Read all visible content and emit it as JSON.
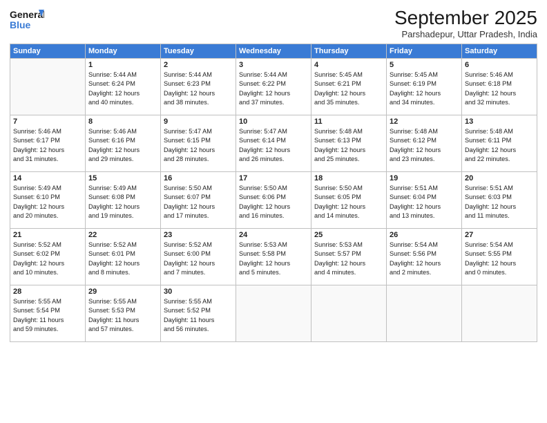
{
  "logo": {
    "line1": "General",
    "line2": "Blue"
  },
  "title": "September 2025",
  "location": "Parshadepur, Uttar Pradesh, India",
  "weekdays": [
    "Sunday",
    "Monday",
    "Tuesday",
    "Wednesday",
    "Thursday",
    "Friday",
    "Saturday"
  ],
  "weeks": [
    [
      {
        "day": "",
        "info": ""
      },
      {
        "day": "1",
        "info": "Sunrise: 5:44 AM\nSunset: 6:24 PM\nDaylight: 12 hours\nand 40 minutes."
      },
      {
        "day": "2",
        "info": "Sunrise: 5:44 AM\nSunset: 6:23 PM\nDaylight: 12 hours\nand 38 minutes."
      },
      {
        "day": "3",
        "info": "Sunrise: 5:44 AM\nSunset: 6:22 PM\nDaylight: 12 hours\nand 37 minutes."
      },
      {
        "day": "4",
        "info": "Sunrise: 5:45 AM\nSunset: 6:21 PM\nDaylight: 12 hours\nand 35 minutes."
      },
      {
        "day": "5",
        "info": "Sunrise: 5:45 AM\nSunset: 6:19 PM\nDaylight: 12 hours\nand 34 minutes."
      },
      {
        "day": "6",
        "info": "Sunrise: 5:46 AM\nSunset: 6:18 PM\nDaylight: 12 hours\nand 32 minutes."
      }
    ],
    [
      {
        "day": "7",
        "info": "Sunrise: 5:46 AM\nSunset: 6:17 PM\nDaylight: 12 hours\nand 31 minutes."
      },
      {
        "day": "8",
        "info": "Sunrise: 5:46 AM\nSunset: 6:16 PM\nDaylight: 12 hours\nand 29 minutes."
      },
      {
        "day": "9",
        "info": "Sunrise: 5:47 AM\nSunset: 6:15 PM\nDaylight: 12 hours\nand 28 minutes."
      },
      {
        "day": "10",
        "info": "Sunrise: 5:47 AM\nSunset: 6:14 PM\nDaylight: 12 hours\nand 26 minutes."
      },
      {
        "day": "11",
        "info": "Sunrise: 5:48 AM\nSunset: 6:13 PM\nDaylight: 12 hours\nand 25 minutes."
      },
      {
        "day": "12",
        "info": "Sunrise: 5:48 AM\nSunset: 6:12 PM\nDaylight: 12 hours\nand 23 minutes."
      },
      {
        "day": "13",
        "info": "Sunrise: 5:48 AM\nSunset: 6:11 PM\nDaylight: 12 hours\nand 22 minutes."
      }
    ],
    [
      {
        "day": "14",
        "info": "Sunrise: 5:49 AM\nSunset: 6:10 PM\nDaylight: 12 hours\nand 20 minutes."
      },
      {
        "day": "15",
        "info": "Sunrise: 5:49 AM\nSunset: 6:08 PM\nDaylight: 12 hours\nand 19 minutes."
      },
      {
        "day": "16",
        "info": "Sunrise: 5:50 AM\nSunset: 6:07 PM\nDaylight: 12 hours\nand 17 minutes."
      },
      {
        "day": "17",
        "info": "Sunrise: 5:50 AM\nSunset: 6:06 PM\nDaylight: 12 hours\nand 16 minutes."
      },
      {
        "day": "18",
        "info": "Sunrise: 5:50 AM\nSunset: 6:05 PM\nDaylight: 12 hours\nand 14 minutes."
      },
      {
        "day": "19",
        "info": "Sunrise: 5:51 AM\nSunset: 6:04 PM\nDaylight: 12 hours\nand 13 minutes."
      },
      {
        "day": "20",
        "info": "Sunrise: 5:51 AM\nSunset: 6:03 PM\nDaylight: 12 hours\nand 11 minutes."
      }
    ],
    [
      {
        "day": "21",
        "info": "Sunrise: 5:52 AM\nSunset: 6:02 PM\nDaylight: 12 hours\nand 10 minutes."
      },
      {
        "day": "22",
        "info": "Sunrise: 5:52 AM\nSunset: 6:01 PM\nDaylight: 12 hours\nand 8 minutes."
      },
      {
        "day": "23",
        "info": "Sunrise: 5:52 AM\nSunset: 6:00 PM\nDaylight: 12 hours\nand 7 minutes."
      },
      {
        "day": "24",
        "info": "Sunrise: 5:53 AM\nSunset: 5:58 PM\nDaylight: 12 hours\nand 5 minutes."
      },
      {
        "day": "25",
        "info": "Sunrise: 5:53 AM\nSunset: 5:57 PM\nDaylight: 12 hours\nand 4 minutes."
      },
      {
        "day": "26",
        "info": "Sunrise: 5:54 AM\nSunset: 5:56 PM\nDaylight: 12 hours\nand 2 minutes."
      },
      {
        "day": "27",
        "info": "Sunrise: 5:54 AM\nSunset: 5:55 PM\nDaylight: 12 hours\nand 0 minutes."
      }
    ],
    [
      {
        "day": "28",
        "info": "Sunrise: 5:55 AM\nSunset: 5:54 PM\nDaylight: 11 hours\nand 59 minutes."
      },
      {
        "day": "29",
        "info": "Sunrise: 5:55 AM\nSunset: 5:53 PM\nDaylight: 11 hours\nand 57 minutes."
      },
      {
        "day": "30",
        "info": "Sunrise: 5:55 AM\nSunset: 5:52 PM\nDaylight: 11 hours\nand 56 minutes."
      },
      {
        "day": "",
        "info": ""
      },
      {
        "day": "",
        "info": ""
      },
      {
        "day": "",
        "info": ""
      },
      {
        "day": "",
        "info": ""
      }
    ]
  ]
}
